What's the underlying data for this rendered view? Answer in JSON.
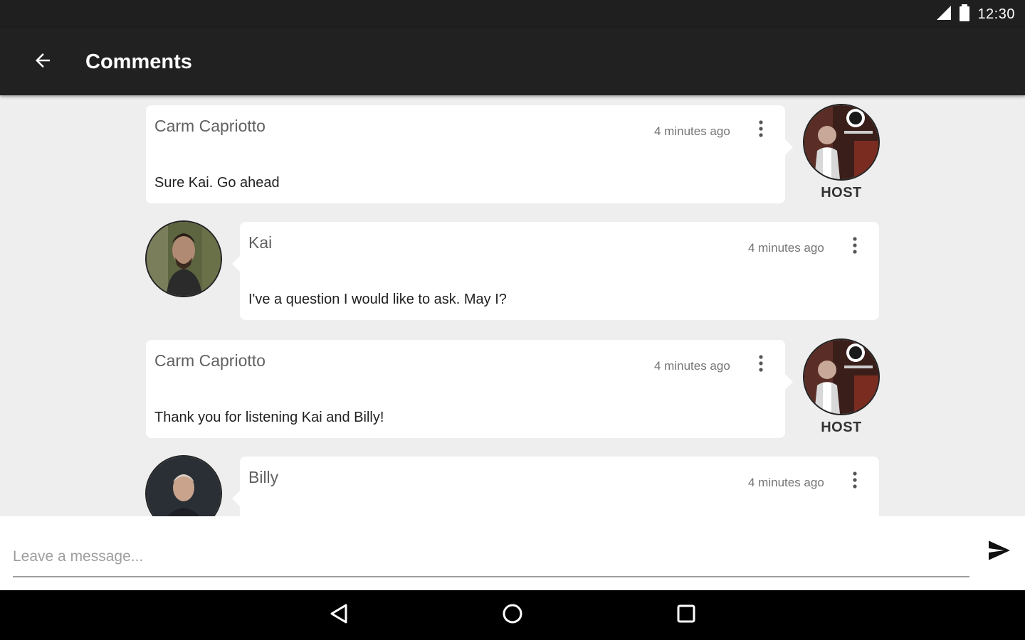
{
  "status_bar": {
    "time": "12:30",
    "signal_icon": "signal-icon",
    "battery_icon": "battery-icon"
  },
  "app_bar": {
    "title": "Comments",
    "back_icon": "arrow-back-icon"
  },
  "comments": [
    {
      "author": "Carm Capriotto",
      "time": "4 minutes ago",
      "message": "Sure Kai. Go ahead",
      "role": "HOST",
      "side": "right"
    },
    {
      "author": "Kai",
      "time": "4 minutes ago",
      "message": "I've a question I would like to ask. May I?",
      "role": "",
      "side": "left"
    },
    {
      "author": "Carm Capriotto",
      "time": "4 minutes ago",
      "message": "Thank you for listening Kai and Billy!",
      "role": "HOST",
      "side": "right"
    },
    {
      "author": "Billy",
      "time": "4 minutes ago",
      "message": "",
      "role": "",
      "side": "left"
    }
  ],
  "composer": {
    "placeholder": "Leave a message...",
    "value": "",
    "send_icon": "send-icon"
  },
  "nav_bar": {
    "back_icon": "nav-back-icon",
    "home_icon": "nav-home-icon",
    "recents_icon": "nav-recents-icon"
  },
  "colors": {
    "app_bar": "#212121",
    "status_bar": "#1f1f1f",
    "background": "#eeeeee",
    "card": "#ffffff",
    "nav_bar": "#000000"
  }
}
